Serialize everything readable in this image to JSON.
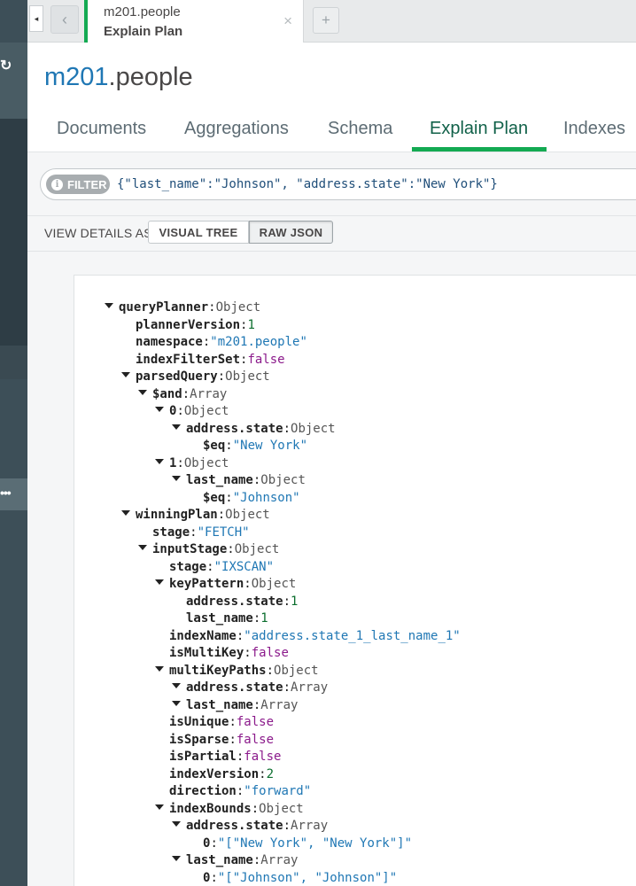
{
  "tabs": {
    "active_tab_line1": "m201.people",
    "active_tab_line2": "Explain Plan",
    "close_glyph": "×",
    "add_glyph": "+",
    "back_glyph": "‹",
    "scroll_left_glyph": "◂"
  },
  "header": {
    "db": "m201",
    "collection": ".people",
    "subtabs": [
      "Documents",
      "Aggregations",
      "Schema",
      "Explain Plan",
      "Indexes"
    ],
    "active_subtab": "Explain Plan"
  },
  "filter": {
    "badge": "FILTER",
    "info_glyph": "i",
    "query": "{\"last_name\":\"Johnson\", \"address.state\":\"New York\"}"
  },
  "view": {
    "label": "VIEW DETAILS AS",
    "visual_tree": "VISUAL TREE",
    "raw_json": "RAW JSON",
    "selected": "RAW JSON"
  },
  "sidebar": {
    "refresh_glyph": "↻",
    "ellipsis_glyph": "•••"
  },
  "json_tree": [
    {
      "depth": 0,
      "caret": true,
      "key": "queryPlanner",
      "kind": "type",
      "value": "Object"
    },
    {
      "depth": 1,
      "caret": false,
      "key": "plannerVersion",
      "kind": "num",
      "value": "1"
    },
    {
      "depth": 1,
      "caret": false,
      "key": "namespace",
      "kind": "str",
      "value": "\"m201.people\""
    },
    {
      "depth": 1,
      "caret": false,
      "key": "indexFilterSet",
      "kind": "bool",
      "value": "false"
    },
    {
      "depth": 1,
      "caret": true,
      "key": "parsedQuery",
      "kind": "type",
      "value": "Object"
    },
    {
      "depth": 2,
      "caret": true,
      "key": "$and",
      "kind": "type",
      "value": "Array"
    },
    {
      "depth": 3,
      "caret": true,
      "key": "0",
      "kind": "type",
      "value": "Object"
    },
    {
      "depth": 4,
      "caret": true,
      "key": "address.state",
      "kind": "type",
      "value": "Object"
    },
    {
      "depth": 5,
      "caret": false,
      "key": "$eq",
      "kind": "str",
      "value": "\"New York\""
    },
    {
      "depth": 3,
      "caret": true,
      "key": "1",
      "kind": "type",
      "value": "Object"
    },
    {
      "depth": 4,
      "caret": true,
      "key": "last_name",
      "kind": "type",
      "value": "Object"
    },
    {
      "depth": 5,
      "caret": false,
      "key": "$eq",
      "kind": "str",
      "value": "\"Johnson\""
    },
    {
      "depth": 1,
      "caret": true,
      "key": "winningPlan",
      "kind": "type",
      "value": "Object"
    },
    {
      "depth": 2,
      "caret": false,
      "key": "stage",
      "kind": "str",
      "value": "\"FETCH\""
    },
    {
      "depth": 2,
      "caret": true,
      "key": "inputStage",
      "kind": "type",
      "value": "Object"
    },
    {
      "depth": 3,
      "caret": false,
      "key": "stage",
      "kind": "str",
      "value": "\"IXSCAN\""
    },
    {
      "depth": 3,
      "caret": true,
      "key": "keyPattern",
      "kind": "type",
      "value": "Object"
    },
    {
      "depth": 4,
      "caret": false,
      "key": "address.state",
      "kind": "num",
      "value": "1"
    },
    {
      "depth": 4,
      "caret": false,
      "key": "last_name",
      "kind": "num",
      "value": "1"
    },
    {
      "depth": 3,
      "caret": false,
      "key": "indexName",
      "kind": "str",
      "value": "\"address.state_1_last_name_1\""
    },
    {
      "depth": 3,
      "caret": false,
      "key": "isMultiKey",
      "kind": "bool",
      "value": "false"
    },
    {
      "depth": 3,
      "caret": true,
      "key": "multiKeyPaths",
      "kind": "type",
      "value": "Object"
    },
    {
      "depth": 4,
      "caret": true,
      "key": "address.state",
      "kind": "type",
      "value": "Array"
    },
    {
      "depth": 4,
      "caret": true,
      "key": "last_name",
      "kind": "type",
      "value": "Array"
    },
    {
      "depth": 3,
      "caret": false,
      "key": "isUnique",
      "kind": "bool",
      "value": "false"
    },
    {
      "depth": 3,
      "caret": false,
      "key": "isSparse",
      "kind": "bool",
      "value": "false"
    },
    {
      "depth": 3,
      "caret": false,
      "key": "isPartial",
      "kind": "bool",
      "value": "false"
    },
    {
      "depth": 3,
      "caret": false,
      "key": "indexVersion",
      "kind": "num",
      "value": "2"
    },
    {
      "depth": 3,
      "caret": false,
      "key": "direction",
      "kind": "str",
      "value": "\"forward\""
    },
    {
      "depth": 3,
      "caret": true,
      "key": "indexBounds",
      "kind": "type",
      "value": "Object"
    },
    {
      "depth": 4,
      "caret": true,
      "key": "address.state",
      "kind": "type",
      "value": "Array"
    },
    {
      "depth": 5,
      "caret": false,
      "key": "0",
      "kind": "str",
      "value": "\"[\"New York\", \"New York\"]\""
    },
    {
      "depth": 4,
      "caret": true,
      "key": "last_name",
      "kind": "type",
      "value": "Array"
    },
    {
      "depth": 5,
      "caret": false,
      "key": "0",
      "kind": "str",
      "value": "\"[\"Johnson\", \"Johnson\"]\""
    }
  ]
}
